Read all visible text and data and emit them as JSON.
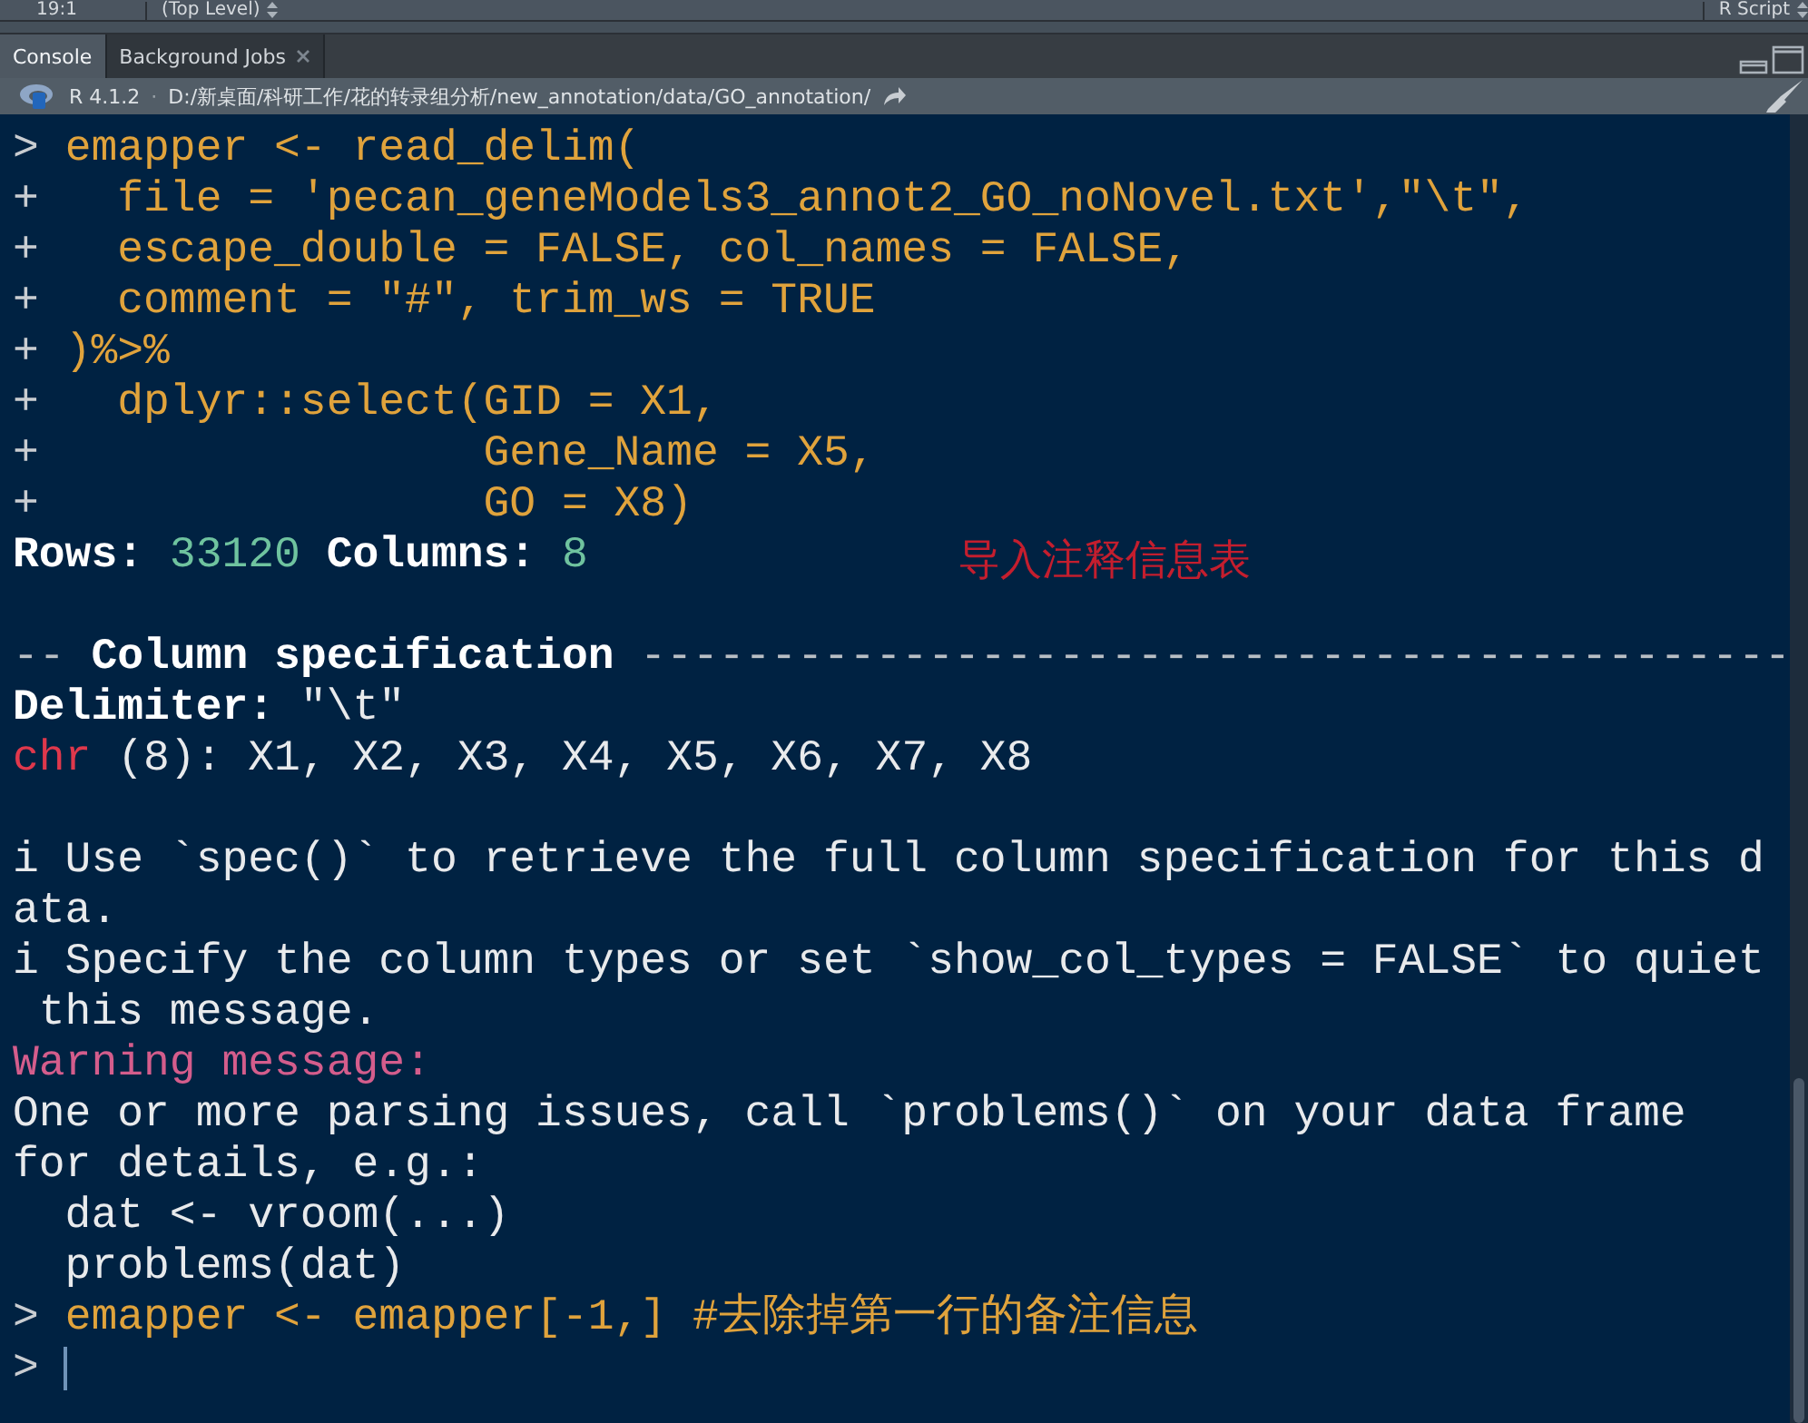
{
  "editor_status": {
    "position": "19:1",
    "scope": "(Top Level)",
    "file_type": "R Script"
  },
  "tabs": [
    {
      "label": "Console",
      "selected": true,
      "closable": false
    },
    {
      "label": "Background Jobs",
      "selected": false,
      "closable": true
    }
  ],
  "console_header": {
    "version": "R 4.1.2",
    "separator": "·",
    "path": "D:/新桌面/科研工作/花的转录组分析/new_annotation/data/GO_annotation/"
  },
  "console_lines": [
    {
      "kind": "text",
      "segments": [
        {
          "kind": "prompt",
          "text": "> "
        },
        {
          "kind": "code",
          "text": "emapper <- read_delim("
        }
      ]
    },
    {
      "kind": "text",
      "segments": [
        {
          "kind": "prompt",
          "text": "+   "
        },
        {
          "kind": "code",
          "text": "file = 'pecan_geneModels3_annot2_GO_noNovel.txt',\"\\t\","
        }
      ]
    },
    {
      "kind": "text",
      "segments": [
        {
          "kind": "prompt",
          "text": "+   "
        },
        {
          "kind": "code",
          "text": "escape_double = FALSE, col_names = FALSE,"
        }
      ]
    },
    {
      "kind": "text",
      "segments": [
        {
          "kind": "prompt",
          "text": "+   "
        },
        {
          "kind": "code",
          "text": "comment = \"#\", trim_ws = TRUE"
        }
      ]
    },
    {
      "kind": "text",
      "segments": [
        {
          "kind": "prompt",
          "text": "+ "
        },
        {
          "kind": "code",
          "text": ")%>%"
        }
      ]
    },
    {
      "kind": "text",
      "segments": [
        {
          "kind": "prompt",
          "text": "+   "
        },
        {
          "kind": "code",
          "text": "dplyr::select(GID = X1,"
        }
      ]
    },
    {
      "kind": "text",
      "segments": [
        {
          "kind": "prompt",
          "text": "+                 "
        },
        {
          "kind": "code",
          "text": "Gene_Name = X5,"
        }
      ]
    },
    {
      "kind": "text",
      "segments": [
        {
          "kind": "prompt",
          "text": "+                 "
        },
        {
          "kind": "code",
          "text": "GO = X8)"
        }
      ]
    },
    {
      "kind": "text",
      "segments": [
        {
          "kind": "bold",
          "text": "Rows: "
        },
        {
          "kind": "number",
          "text": "33120"
        },
        {
          "kind": "bold",
          "text": " Columns: "
        },
        {
          "kind": "number",
          "text": "8"
        }
      ],
      "note": "导入注释信息表"
    },
    {
      "kind": "blank"
    },
    {
      "kind": "text",
      "segments": [
        {
          "kind": "dim",
          "text": "-- "
        },
        {
          "kind": "bold",
          "text": "Column specification"
        },
        {
          "kind": "dim",
          "text": " --------------------------------------------"
        }
      ]
    },
    {
      "kind": "text",
      "segments": [
        {
          "kind": "bold",
          "text": "Delimiter: "
        },
        {
          "kind": "plain",
          "text": "\"\\t\""
        }
      ]
    },
    {
      "kind": "text",
      "segments": [
        {
          "kind": "red",
          "text": "chr"
        },
        {
          "kind": "plain",
          "text": " (8): X1, X2, X3, X4, X5, X6, X7, X8"
        }
      ]
    },
    {
      "kind": "blank"
    },
    {
      "kind": "text",
      "segments": [
        {
          "kind": "plain",
          "text": "i Use `spec()` to retrieve the full column specification for this d"
        }
      ]
    },
    {
      "kind": "text",
      "segments": [
        {
          "kind": "plain",
          "text": "ata."
        }
      ]
    },
    {
      "kind": "text",
      "segments": [
        {
          "kind": "plain",
          "text": "i Specify the column types or set `show_col_types = FALSE` to quiet"
        }
      ]
    },
    {
      "kind": "text",
      "segments": [
        {
          "kind": "plain",
          "text": " this message."
        }
      ]
    },
    {
      "kind": "text",
      "segments": [
        {
          "kind": "warning",
          "text": "Warning message:"
        }
      ]
    },
    {
      "kind": "text",
      "segments": [
        {
          "kind": "plain",
          "text": "One or more parsing issues, call `problems()` on your data frame"
        }
      ]
    },
    {
      "kind": "text",
      "segments": [
        {
          "kind": "plain",
          "text": "for details, e.g.:"
        }
      ]
    },
    {
      "kind": "text",
      "segments": [
        {
          "kind": "plain",
          "text": "  dat <- vroom(...)"
        }
      ]
    },
    {
      "kind": "text",
      "segments": [
        {
          "kind": "plain",
          "text": "  problems(dat)"
        }
      ]
    },
    {
      "kind": "text",
      "segments": [
        {
          "kind": "prompt",
          "text": "> "
        },
        {
          "kind": "code",
          "text": "emapper <- emapper[-1,] #去除掉第一行的备注信息"
        }
      ]
    },
    {
      "kind": "input",
      "prompt": ">"
    }
  ]
}
